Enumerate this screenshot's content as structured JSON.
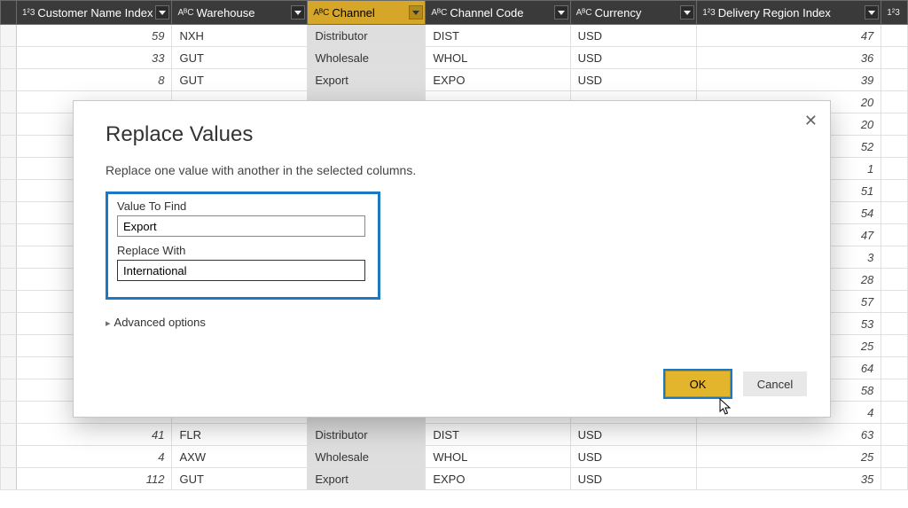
{
  "columns": {
    "customer_index": {
      "label": "Customer Name Index",
      "type": "1²3"
    },
    "warehouse": {
      "label": "Warehouse",
      "type": "AᴮC"
    },
    "channel": {
      "label": "Channel",
      "type": "AᴮC"
    },
    "channel_code": {
      "label": "Channel Code",
      "type": "AᴮC"
    },
    "currency": {
      "label": "Currency",
      "type": "AᴮC"
    },
    "delivery_region": {
      "label": "Delivery Region Index",
      "type": "1²3"
    },
    "next": {
      "label": "",
      "type": "1²3"
    }
  },
  "rows": [
    {
      "ci": "59",
      "wh": "NXH",
      "ch": "Distributor",
      "cc": "DIST",
      "cu": "USD",
      "dr": "47"
    },
    {
      "ci": "33",
      "wh": "GUT",
      "ch": "Wholesale",
      "cc": "WHOL",
      "cu": "USD",
      "dr": "36"
    },
    {
      "ci": "8",
      "wh": "GUT",
      "ch": "Export",
      "cc": "EXPO",
      "cu": "USD",
      "dr": "39"
    },
    {
      "ci": "",
      "wh": "",
      "ch": "",
      "cc": "",
      "cu": "",
      "dr": "20"
    },
    {
      "ci": "",
      "wh": "",
      "ch": "",
      "cc": "",
      "cu": "",
      "dr": "20"
    },
    {
      "ci": "",
      "wh": "",
      "ch": "",
      "cc": "",
      "cu": "",
      "dr": "52"
    },
    {
      "ci": "",
      "wh": "",
      "ch": "",
      "cc": "",
      "cu": "",
      "dr": "1"
    },
    {
      "ci": "",
      "wh": "",
      "ch": "",
      "cc": "",
      "cu": "",
      "dr": "51"
    },
    {
      "ci": "",
      "wh": "",
      "ch": "",
      "cc": "",
      "cu": "",
      "dr": "54"
    },
    {
      "ci": "",
      "wh": "",
      "ch": "",
      "cc": "",
      "cu": "",
      "dr": "47"
    },
    {
      "ci": "",
      "wh": "",
      "ch": "",
      "cc": "",
      "cu": "",
      "dr": "3"
    },
    {
      "ci": "",
      "wh": "",
      "ch": "",
      "cc": "",
      "cu": "",
      "dr": "28"
    },
    {
      "ci": "",
      "wh": "",
      "ch": "",
      "cc": "",
      "cu": "",
      "dr": "57"
    },
    {
      "ci": "",
      "wh": "",
      "ch": "",
      "cc": "",
      "cu": "",
      "dr": "53"
    },
    {
      "ci": "",
      "wh": "",
      "ch": "",
      "cc": "",
      "cu": "",
      "dr": "25"
    },
    {
      "ci": "",
      "wh": "",
      "ch": "",
      "cc": "",
      "cu": "",
      "dr": "64"
    },
    {
      "ci": "",
      "wh": "",
      "ch": "",
      "cc": "",
      "cu": "",
      "dr": "58"
    },
    {
      "ci": "",
      "wh": "",
      "ch": "",
      "cc": "",
      "cu": "",
      "dr": "4"
    },
    {
      "ci": "41",
      "wh": "FLR",
      "ch": "Distributor",
      "cc": "DIST",
      "cu": "USD",
      "dr": "63"
    },
    {
      "ci": "4",
      "wh": "AXW",
      "ch": "Wholesale",
      "cc": "WHOL",
      "cu": "USD",
      "dr": "25"
    },
    {
      "ci": "112",
      "wh": "GUT",
      "ch": "Export",
      "cc": "EXPO",
      "cu": "USD",
      "dr": "35"
    }
  ],
  "dialog": {
    "title": "Replace Values",
    "description": "Replace one value with another in the selected columns.",
    "find_label": "Value To Find",
    "find_value": "Export",
    "replace_label": "Replace With",
    "replace_value": "International",
    "advanced": "Advanced options",
    "ok": "OK",
    "cancel": "Cancel"
  }
}
